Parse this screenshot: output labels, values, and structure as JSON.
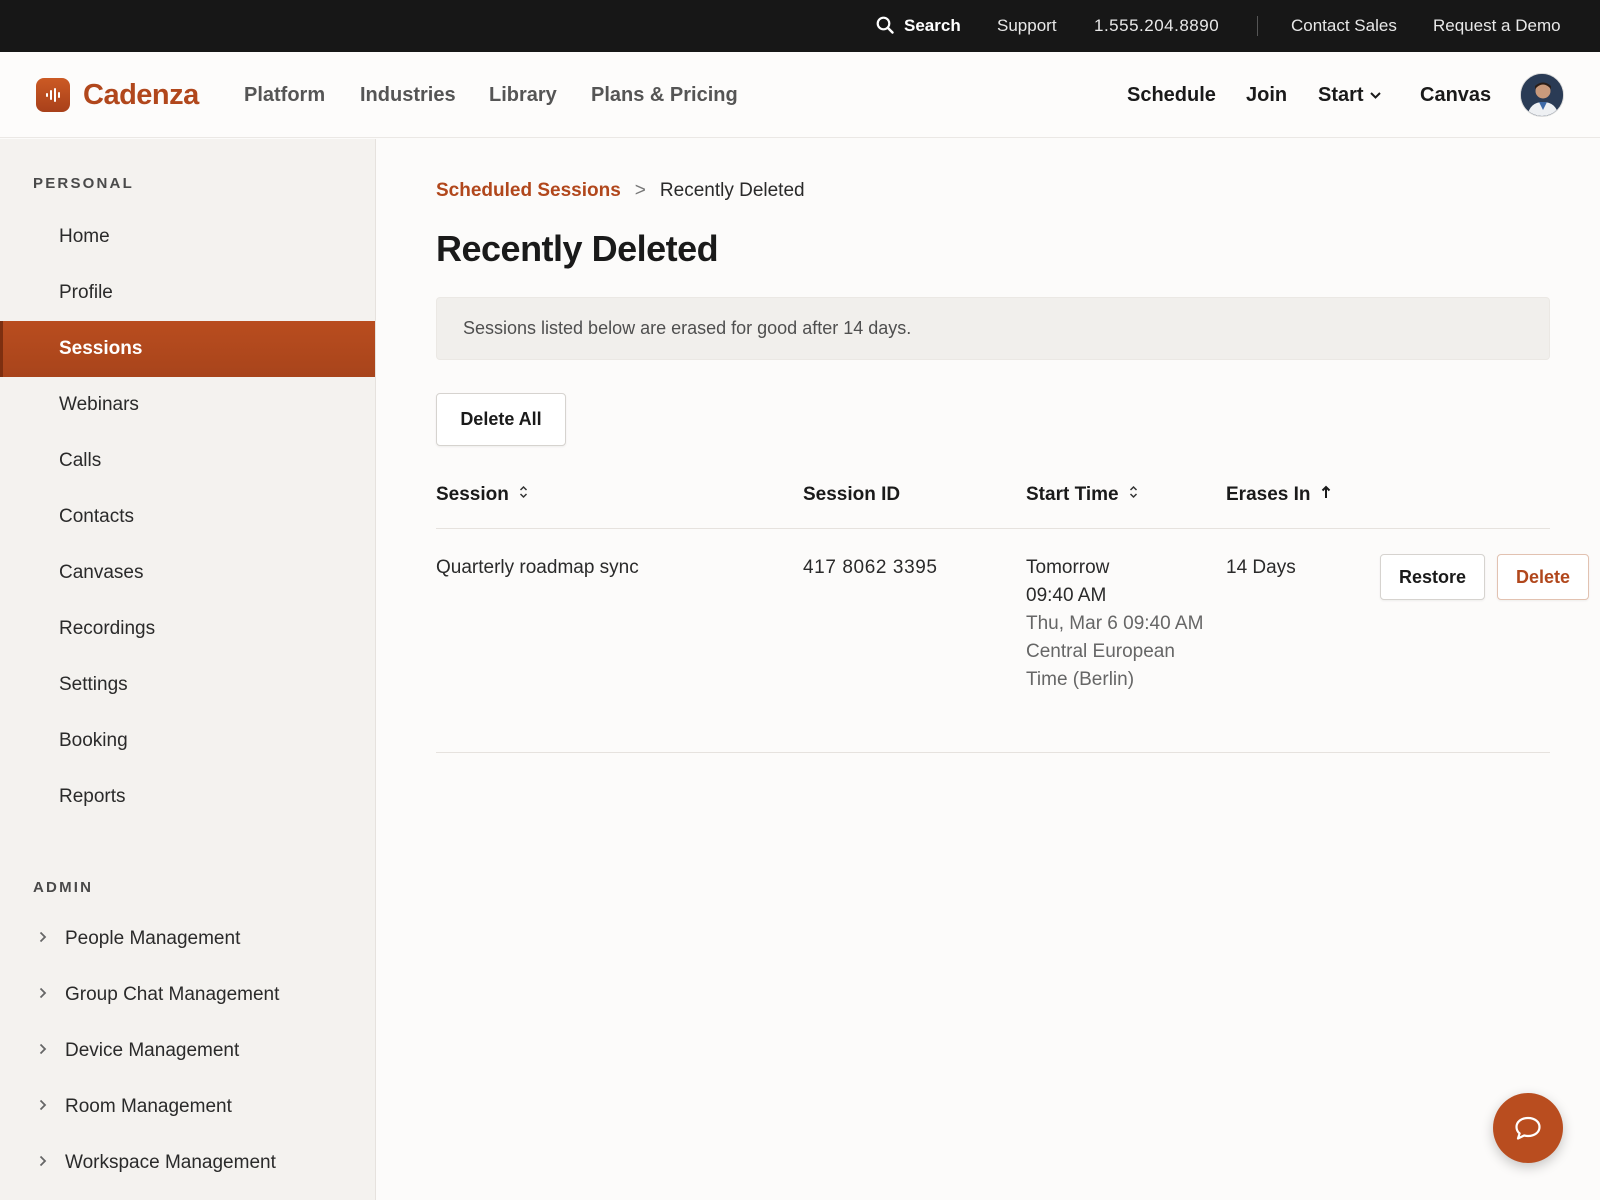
{
  "topbar": {
    "search_label": "Search",
    "support_label": "Support",
    "phone": "1.555.204.8890",
    "contact_sales_label": "Contact Sales",
    "request_demo_label": "Request a Demo"
  },
  "brand": {
    "name": "Cadenza",
    "accent_color": "#b1471c"
  },
  "header": {
    "nav": [
      "Platform",
      "Industries",
      "Library",
      "Plans & Pricing"
    ],
    "actions": [
      "Schedule",
      "Join",
      "Start",
      "Canvas"
    ]
  },
  "sidebar": {
    "personal_heading": "PERSONAL",
    "items": [
      {
        "label": "Home"
      },
      {
        "label": "Profile"
      },
      {
        "label": "Sessions",
        "active": true
      },
      {
        "label": "Webinars"
      },
      {
        "label": "Calls"
      },
      {
        "label": "Contacts"
      },
      {
        "label": "Canvases"
      },
      {
        "label": "Recordings"
      },
      {
        "label": "Settings"
      },
      {
        "label": "Booking"
      },
      {
        "label": "Reports"
      }
    ],
    "admin_heading": "ADMIN",
    "admin_items": [
      {
        "label": "People Management"
      },
      {
        "label": "Group Chat Management"
      },
      {
        "label": "Device Management"
      },
      {
        "label": "Room Management"
      },
      {
        "label": "Workspace Management"
      }
    ]
  },
  "breadcrumb": {
    "parent": "Scheduled Sessions",
    "separator": ">",
    "current": "Recently Deleted"
  },
  "page": {
    "title": "Recently Deleted",
    "notice": "Sessions listed below are erased for good after 14 days.",
    "delete_all_label": "Delete All"
  },
  "table": {
    "columns": [
      "Session",
      "Session ID",
      "Start Time",
      "Erases In"
    ],
    "rows": [
      {
        "session": "Quarterly roadmap sync",
        "session_id": "417 8062 3395",
        "start_day": "Tomorrow",
        "start_time": "09:40 AM",
        "start_date": "Thu, Mar 6 09:40 AM",
        "timezone": "Central European Time (Berlin)",
        "erases_in": "14 Days",
        "restore_label": "Restore",
        "delete_label": "Delete"
      }
    ]
  },
  "icons": {
    "search": "search-icon",
    "chevron_down": "chevron-down-icon",
    "sort": "sort-icon",
    "sort_asc": "arrow-up-icon",
    "chevron_right": "chevron-right-icon",
    "chat": "chat-bubble-icon"
  }
}
